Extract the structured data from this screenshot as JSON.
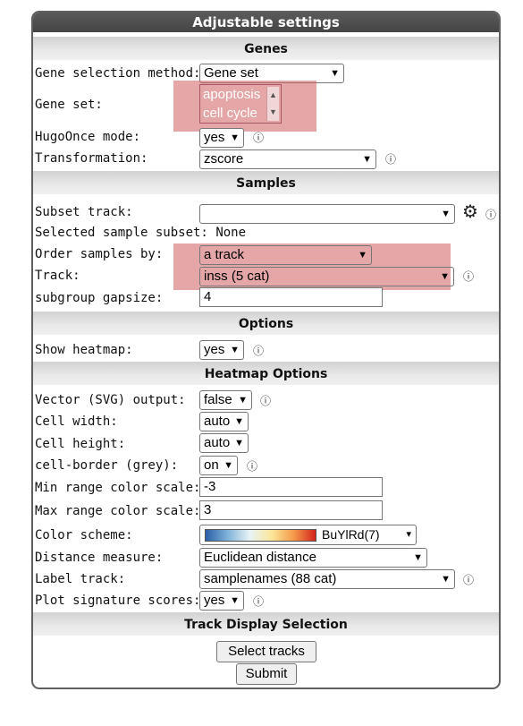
{
  "title": "Adjustable settings",
  "sections": {
    "genes": "Genes",
    "samples": "Samples",
    "options": "Options",
    "heatmap": "Heatmap Options",
    "track_display": "Track Display Selection"
  },
  "genes": {
    "gene_selection_method": {
      "label": "Gene selection method:",
      "value": "Gene set"
    },
    "gene_set": {
      "label": "Gene set:",
      "options": [
        "apoptosis",
        "cell cycle"
      ]
    },
    "hugoonce": {
      "label": "HugoOnce mode:",
      "value": "yes"
    },
    "transformation": {
      "label": "Transformation:",
      "value": "zscore"
    }
  },
  "samples": {
    "subset_track": {
      "label": "Subset track:",
      "value": ""
    },
    "selected_subset": {
      "label": "Selected sample subset:",
      "value": "None"
    },
    "order_by": {
      "label": "Order samples by:",
      "value": "a track"
    },
    "track": {
      "label": "Track:",
      "value": "inss (5 cat)"
    },
    "gapsize": {
      "label": "subgroup gapsize:",
      "value": "4"
    }
  },
  "options": {
    "show_heatmap": {
      "label": "Show heatmap:",
      "value": "yes"
    }
  },
  "heatmap": {
    "svg_output": {
      "label": "Vector (SVG) output:",
      "value": "false"
    },
    "cell_width": {
      "label": "Cell width:",
      "value": "auto"
    },
    "cell_height": {
      "label": "Cell height:",
      "value": "auto"
    },
    "cell_border": {
      "label": "cell-border (grey):",
      "value": "on"
    },
    "min_range": {
      "label": "Min range color scale:",
      "value": "-3"
    },
    "max_range": {
      "label": "Max range color scale:",
      "value": "3"
    },
    "color_scheme": {
      "label": "Color scheme:",
      "value": "BuYlRd(7)"
    },
    "distance": {
      "label": "Distance measure:",
      "value": "Euclidean distance"
    },
    "label_track": {
      "label": "Label track:",
      "value": "samplenames (88 cat)"
    },
    "signature": {
      "label": "Plot signature scores:",
      "value": "yes"
    }
  },
  "buttons": {
    "select_tracks": "Select tracks",
    "submit": "Submit"
  },
  "icons": {
    "info": "ⓘ",
    "gear": "⚙",
    "chevron": "⌄"
  },
  "colors": {
    "highlight": "#cd5c5c",
    "header": "#4f4f4f"
  }
}
